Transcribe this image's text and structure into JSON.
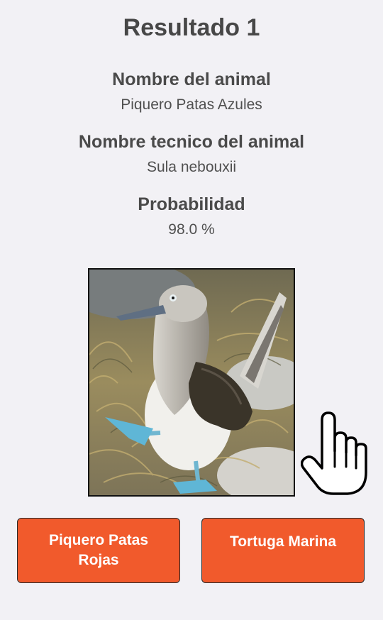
{
  "result": {
    "title": "Resultado 1",
    "fields": [
      {
        "label": "Nombre del animal",
        "value": "Piquero Patas Azules"
      },
      {
        "label": "Nombre tecnico del animal",
        "value": "Sula nebouxii"
      },
      {
        "label": "Probabilidad",
        "value": "98.0 %"
      }
    ]
  },
  "image": {
    "icon": "blue-footed-booby-photo"
  },
  "pointer": {
    "icon": "hand-pointer-icon"
  },
  "options": [
    {
      "label": "Piquero Patas Rojas"
    },
    {
      "label": "Tortuga Marina"
    }
  ],
  "colors": {
    "background": "#f2f1f5",
    "button": "#f15a2c",
    "button_text": "#ffffff"
  }
}
